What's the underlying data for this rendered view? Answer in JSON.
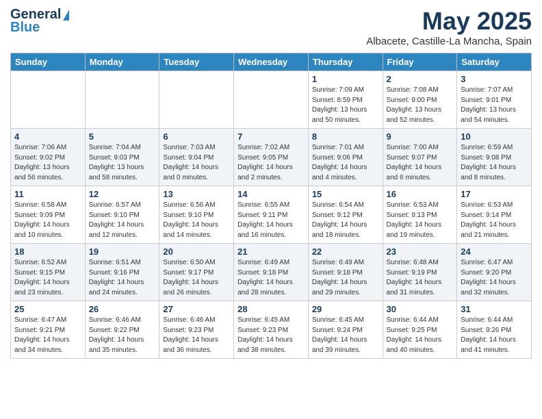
{
  "header": {
    "logo_line1": "General",
    "logo_line2": "Blue",
    "month": "May 2025",
    "location": "Albacete, Castille-La Mancha, Spain"
  },
  "days_of_week": [
    "Sunday",
    "Monday",
    "Tuesday",
    "Wednesday",
    "Thursday",
    "Friday",
    "Saturday"
  ],
  "weeks": [
    [
      {
        "day": "",
        "info": ""
      },
      {
        "day": "",
        "info": ""
      },
      {
        "day": "",
        "info": ""
      },
      {
        "day": "",
        "info": ""
      },
      {
        "day": "1",
        "info": "Sunrise: 7:09 AM\nSunset: 8:59 PM\nDaylight: 13 hours\nand 50 minutes."
      },
      {
        "day": "2",
        "info": "Sunrise: 7:08 AM\nSunset: 9:00 PM\nDaylight: 13 hours\nand 52 minutes."
      },
      {
        "day": "3",
        "info": "Sunrise: 7:07 AM\nSunset: 9:01 PM\nDaylight: 13 hours\nand 54 minutes."
      }
    ],
    [
      {
        "day": "4",
        "info": "Sunrise: 7:06 AM\nSunset: 9:02 PM\nDaylight: 13 hours\nand 56 minutes."
      },
      {
        "day": "5",
        "info": "Sunrise: 7:04 AM\nSunset: 9:03 PM\nDaylight: 13 hours\nand 58 minutes."
      },
      {
        "day": "6",
        "info": "Sunrise: 7:03 AM\nSunset: 9:04 PM\nDaylight: 14 hours\nand 0 minutes."
      },
      {
        "day": "7",
        "info": "Sunrise: 7:02 AM\nSunset: 9:05 PM\nDaylight: 14 hours\nand 2 minutes."
      },
      {
        "day": "8",
        "info": "Sunrise: 7:01 AM\nSunset: 9:06 PM\nDaylight: 14 hours\nand 4 minutes."
      },
      {
        "day": "9",
        "info": "Sunrise: 7:00 AM\nSunset: 9:07 PM\nDaylight: 14 hours\nand 6 minutes."
      },
      {
        "day": "10",
        "info": "Sunrise: 6:59 AM\nSunset: 9:08 PM\nDaylight: 14 hours\nand 8 minutes."
      }
    ],
    [
      {
        "day": "11",
        "info": "Sunrise: 6:58 AM\nSunset: 9:09 PM\nDaylight: 14 hours\nand 10 minutes."
      },
      {
        "day": "12",
        "info": "Sunrise: 6:57 AM\nSunset: 9:10 PM\nDaylight: 14 hours\nand 12 minutes."
      },
      {
        "day": "13",
        "info": "Sunrise: 6:56 AM\nSunset: 9:10 PM\nDaylight: 14 hours\nand 14 minutes."
      },
      {
        "day": "14",
        "info": "Sunrise: 6:55 AM\nSunset: 9:11 PM\nDaylight: 14 hours\nand 16 minutes."
      },
      {
        "day": "15",
        "info": "Sunrise: 6:54 AM\nSunset: 9:12 PM\nDaylight: 14 hours\nand 18 minutes."
      },
      {
        "day": "16",
        "info": "Sunrise: 6:53 AM\nSunset: 9:13 PM\nDaylight: 14 hours\nand 19 minutes."
      },
      {
        "day": "17",
        "info": "Sunrise: 6:53 AM\nSunset: 9:14 PM\nDaylight: 14 hours\nand 21 minutes."
      }
    ],
    [
      {
        "day": "18",
        "info": "Sunrise: 6:52 AM\nSunset: 9:15 PM\nDaylight: 14 hours\nand 23 minutes."
      },
      {
        "day": "19",
        "info": "Sunrise: 6:51 AM\nSunset: 9:16 PM\nDaylight: 14 hours\nand 24 minutes."
      },
      {
        "day": "20",
        "info": "Sunrise: 6:50 AM\nSunset: 9:17 PM\nDaylight: 14 hours\nand 26 minutes."
      },
      {
        "day": "21",
        "info": "Sunrise: 6:49 AM\nSunset: 9:18 PM\nDaylight: 14 hours\nand 28 minutes."
      },
      {
        "day": "22",
        "info": "Sunrise: 6:49 AM\nSunset: 9:18 PM\nDaylight: 14 hours\nand 29 minutes."
      },
      {
        "day": "23",
        "info": "Sunrise: 6:48 AM\nSunset: 9:19 PM\nDaylight: 14 hours\nand 31 minutes."
      },
      {
        "day": "24",
        "info": "Sunrise: 6:47 AM\nSunset: 9:20 PM\nDaylight: 14 hours\nand 32 minutes."
      }
    ],
    [
      {
        "day": "25",
        "info": "Sunrise: 6:47 AM\nSunset: 9:21 PM\nDaylight: 14 hours\nand 34 minutes."
      },
      {
        "day": "26",
        "info": "Sunrise: 6:46 AM\nSunset: 9:22 PM\nDaylight: 14 hours\nand 35 minutes."
      },
      {
        "day": "27",
        "info": "Sunrise: 6:46 AM\nSunset: 9:23 PM\nDaylight: 14 hours\nand 36 minutes."
      },
      {
        "day": "28",
        "info": "Sunrise: 6:45 AM\nSunset: 9:23 PM\nDaylight: 14 hours\nand 38 minutes."
      },
      {
        "day": "29",
        "info": "Sunrise: 6:45 AM\nSunset: 9:24 PM\nDaylight: 14 hours\nand 39 minutes."
      },
      {
        "day": "30",
        "info": "Sunrise: 6:44 AM\nSunset: 9:25 PM\nDaylight: 14 hours\nand 40 minutes."
      },
      {
        "day": "31",
        "info": "Sunrise: 6:44 AM\nSunset: 9:26 PM\nDaylight: 14 hours\nand 41 minutes."
      }
    ]
  ]
}
